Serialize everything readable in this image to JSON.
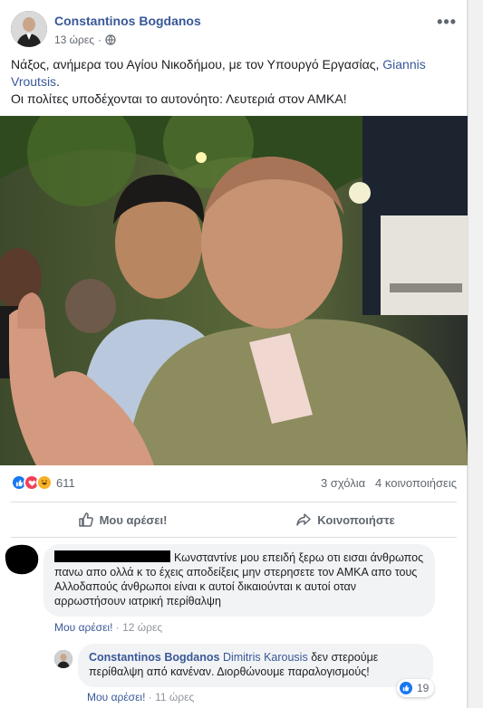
{
  "post": {
    "author": "Constantinos Bogdanos",
    "time": "13 ώρες",
    "text_line1": "Νάξος, ανήμερα του Αγίου Νικοδήμου, με τον Υπουργό Εργασίας, ",
    "text_tag": "Giannis Vroutsis",
    "text_line1_end": ".",
    "text_line2": "Οι πολίτες υποδέχονται το αυτονόητο: Λευτεριά στον ΑΜΚΑ!",
    "more_label": "•••"
  },
  "stats": {
    "reaction_count": "611",
    "comments": "3 σχόλια",
    "shares": "4 κοινοποιήσεις",
    "reaction_icons": [
      "like-icon",
      "love-icon",
      "haha-icon"
    ]
  },
  "actions": {
    "like": "Μου αρέσει!",
    "share": "Κοινοποιήστε"
  },
  "comments": [
    {
      "author_redacted": true,
      "text": "Κωνσταντίνε μου επειδή ξερω οτι εισαι άνθρωπος πανω απο ολλά κ το έχεις αποδείξεις μην στερησετε τον ΑΜΚΑ απο τους Αλλοδαπούς άνθρωποι είναι κ αυτοί δικαιούνται κ αυτοί οταν αρρωστήσουν ιατρική περίθαλψη",
      "like_label": "Μου αρέσει!",
      "separator": "·",
      "time": "12 ώρες"
    },
    {
      "author": "Constantinos Bogdanos",
      "tag": "Dimitris Karousis",
      "text": "δεν στερούμε περίθαλψη από κανέναν. Διορθώνουμε παραλογισμούς!",
      "like_label": "Μου αρέσει!",
      "separator": "·",
      "time": "11 ώρες",
      "reaction_count": "19"
    }
  ],
  "colors": {
    "link": "#385898",
    "like_blue": "#1877f2",
    "love_red": "#f33e58",
    "haha_yellow": "#f7b125"
  }
}
